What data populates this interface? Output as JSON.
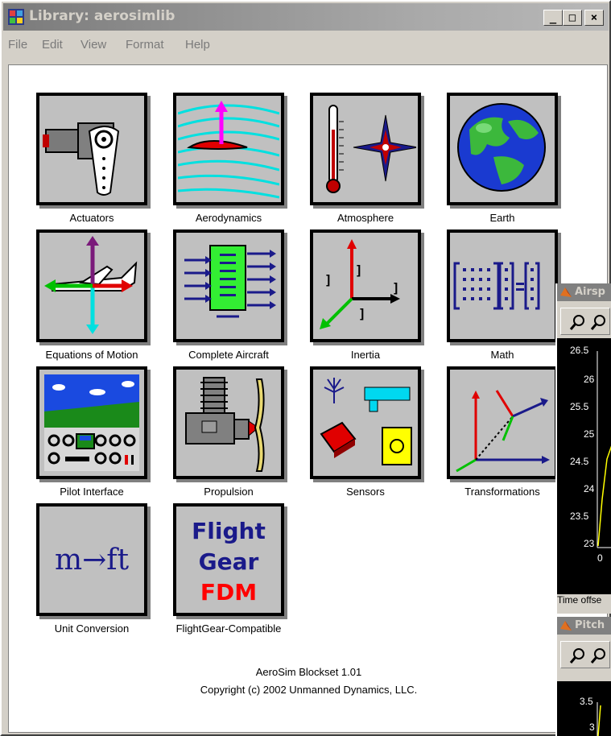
{
  "window": {
    "title": "Library: aerosimlib"
  },
  "window_buttons": {
    "minimize": "_",
    "maximize": "□",
    "close": "×"
  },
  "menu": [
    "File",
    "Edit",
    "View",
    "Format",
    "Help"
  ],
  "blocks": [
    {
      "label": "Actuators",
      "icon": "actuator-servo-icon"
    },
    {
      "label": "Aerodynamics",
      "icon": "airfoil-lift-icon"
    },
    {
      "label": "Atmosphere",
      "icon": "thermometer-compass-icon"
    },
    {
      "label": "Earth",
      "icon": "globe-icon"
    },
    {
      "label": "Equations of Motion",
      "icon": "aircraft-axes-icon"
    },
    {
      "label": "Complete Aircraft",
      "icon": "complete-aircraft-block-icon"
    },
    {
      "label": "Inertia",
      "icon": "inertia-axes-icon"
    },
    {
      "label": "Math",
      "icon": "matrix-icon"
    },
    {
      "label": "Pilot Interface",
      "icon": "cockpit-icon"
    },
    {
      "label": "Propulsion",
      "icon": "engine-propeller-icon"
    },
    {
      "label": "Sensors",
      "icon": "sensors-icon"
    },
    {
      "label": "Transformations",
      "icon": "coordinate-frames-icon"
    },
    {
      "label": "Unit Conversion",
      "icon": "unit-conversion-icon",
      "glyph": "m→ft"
    },
    {
      "label": "FlightGear-Compatible",
      "icon": "flightgear-fdm-icon",
      "lines": [
        "Flight",
        "Gear",
        "FDM"
      ]
    }
  ],
  "footer": {
    "line1": "AeroSim Blockset 1.01",
    "line2": "Copyright (c) 2002 Unmanned Dynamics, LLC."
  },
  "scope_airspeed": {
    "title": "Airsp",
    "yticks": [
      "26.5",
      "26",
      "25.5",
      "25",
      "24.5",
      "24",
      "23.5",
      "23"
    ],
    "xtick": "0",
    "footer": "Time offse"
  },
  "scope_pitch": {
    "title": "Pitch",
    "yticks": [
      "3.5",
      "3"
    ]
  },
  "colors": {
    "titlebar_inactive": "#808080",
    "face": "#d4d0c8",
    "canvas": "#ffffff"
  }
}
